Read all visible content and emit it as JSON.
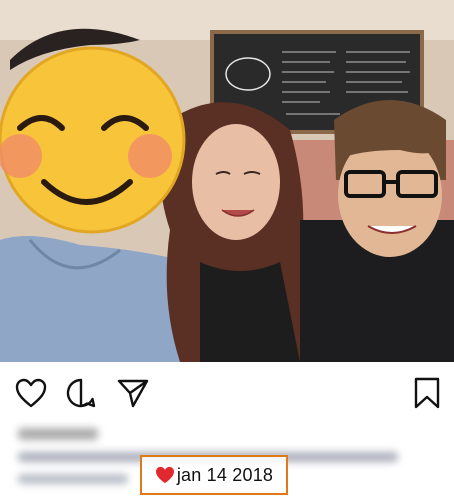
{
  "post": {
    "photo_alt": "",
    "actions": {
      "like_icon": "heart-outline-icon",
      "comment_icon": "comment-bubble-icon",
      "share_icon": "paper-plane-icon",
      "save_icon": "bookmark-icon"
    },
    "caption_visible": false,
    "date_label": "jan 14 2018",
    "date_emoji": "red-heart",
    "highlight_color": "#e07a18"
  }
}
